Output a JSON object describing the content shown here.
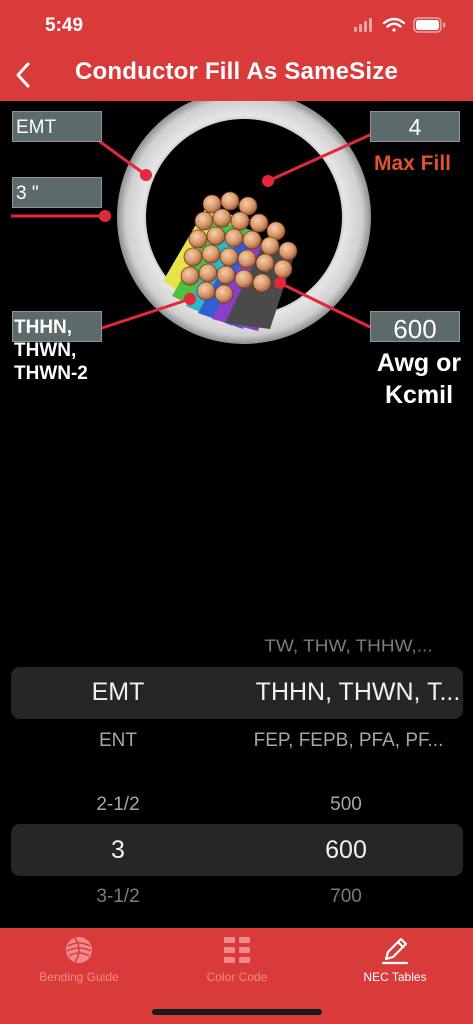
{
  "status_bar": {
    "time": "5:49"
  },
  "nav": {
    "title": "Conductor Fill As SameSize"
  },
  "diagram": {
    "raceway_type": "EMT",
    "trade_size": "3 \"",
    "insulation_type": "THHN,\nTHWN,\nTHWN-2",
    "max_fill_value": "4",
    "max_fill_label": "Max Fill",
    "conductor_size": "600",
    "conductor_size_unit": "Awg or\nKcmil"
  },
  "picker_type": {
    "rows": [
      {
        "left": "",
        "right": "TW, THW, THHW,..."
      },
      {
        "left": "EMT",
        "right": "THHN, THWN, T..."
      },
      {
        "left": "ENT",
        "right": "FEP, FEPB, PFA, PF..."
      }
    ]
  },
  "picker_size": {
    "rows": [
      {
        "left": "2-1/2",
        "right": "500"
      },
      {
        "left": "3",
        "right": "600"
      },
      {
        "left": "3-1/2",
        "right": "700"
      }
    ]
  },
  "tabbar": {
    "tabs": [
      {
        "label": "Bending Guide",
        "icon": "globe-icon",
        "active": false
      },
      {
        "label": "Color Code",
        "icon": "grid-icon",
        "active": false
      },
      {
        "label": "NEC Tables",
        "icon": "pencil-icon",
        "active": true
      }
    ]
  },
  "colors": {
    "brand_red": "#d93b3b",
    "accent_orange": "#e2512d",
    "chip_gray": "#5d6a6b"
  }
}
